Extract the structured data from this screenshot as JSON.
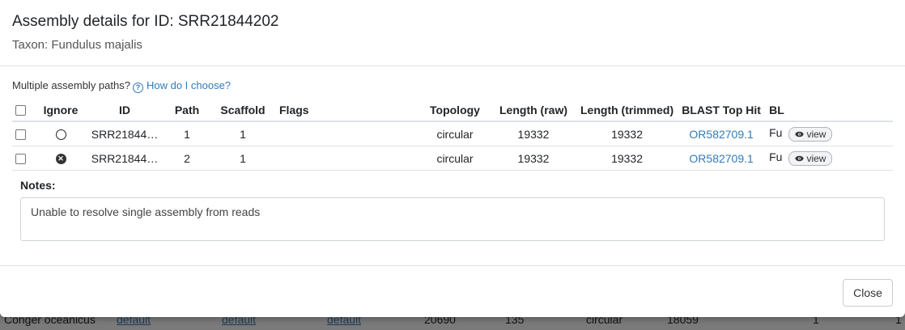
{
  "background": {
    "row": [
      "Conger oceanicus",
      "default",
      "default",
      "default",
      "20690",
      "135",
      "circular",
      "18059",
      "1",
      "1"
    ]
  },
  "modal": {
    "title": "Assembly details for ID: SRR21844202",
    "taxon": "Taxon: Fundulus majalis",
    "paths_question": "Multiple assembly paths?",
    "help_link": "How do I choose?",
    "table": {
      "headers": [
        "Ignore",
        "ID",
        "Path",
        "Scaffold",
        "Flags",
        "Topology",
        "Length (raw)",
        "Length (trimmed)",
        "BLAST Top Hit",
        "BL"
      ],
      "rows": [
        {
          "ignore": "empty",
          "id": "SRR21844…",
          "path": "1",
          "scaffold": "1",
          "flags": "",
          "topology": "circular",
          "length_raw": "19332",
          "length_trimmed": "19332",
          "blast_hit": "OR582709.1",
          "bl": "Fu",
          "view": "view"
        },
        {
          "ignore": "selected",
          "id": "SRR21844…",
          "path": "2",
          "scaffold": "1",
          "flags": "",
          "topology": "circular",
          "length_raw": "19332",
          "length_trimmed": "19332",
          "blast_hit": "OR582709.1",
          "bl": "Fu",
          "view": "view"
        }
      ]
    },
    "notes_label": "Notes:",
    "notes_value": "Unable to resolve single assembly from reads",
    "close_label": "Close"
  }
}
